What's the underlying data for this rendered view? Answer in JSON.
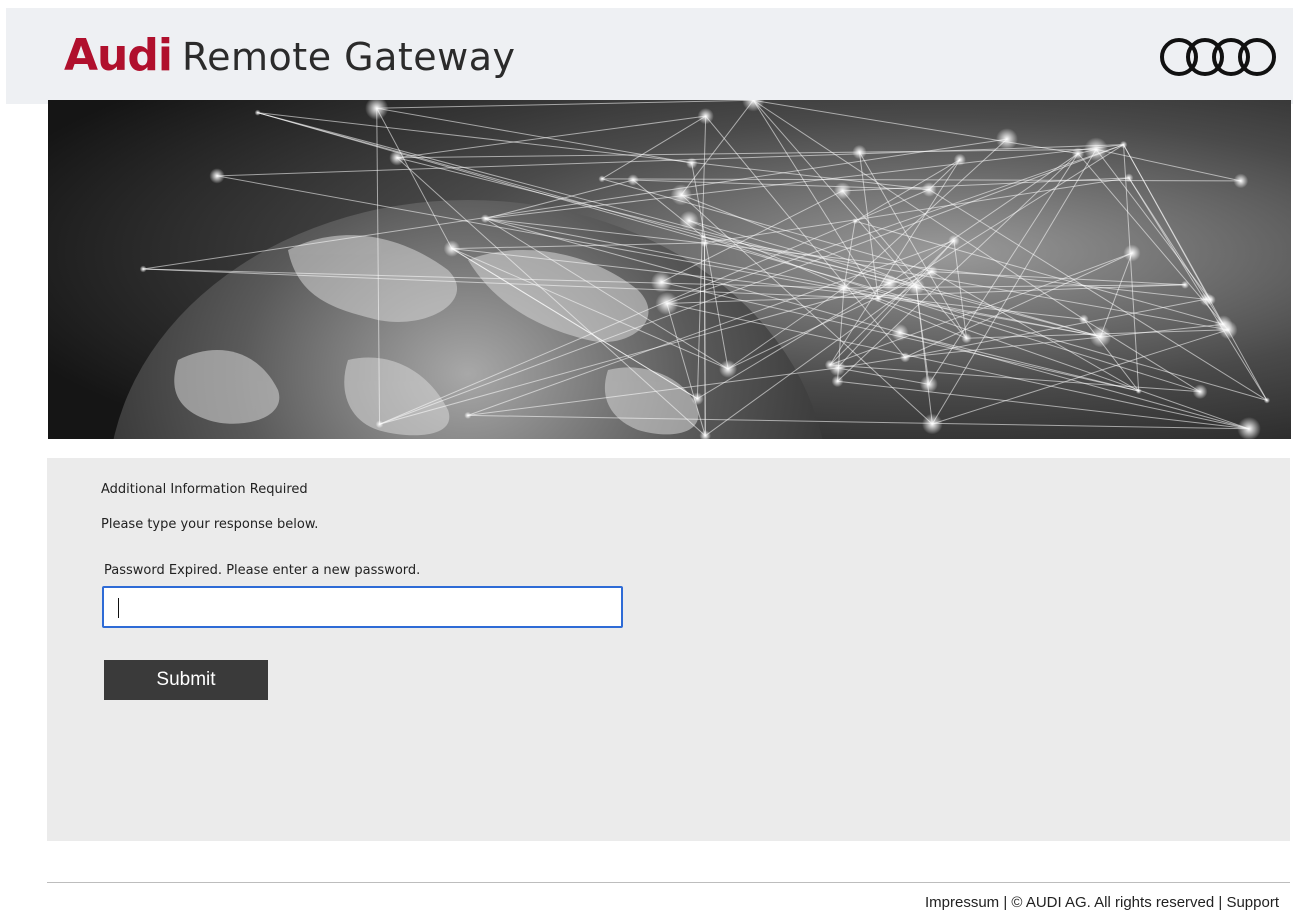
{
  "header": {
    "brand_primary": "Audi",
    "brand_secondary": "Remote Gateway",
    "logo_icon": "audi-rings-logo",
    "brand_color": "#b0102d"
  },
  "hero": {
    "image": "globe-network-photo"
  },
  "form": {
    "heading": "Additional Information Required",
    "instruction": "Please type your response below.",
    "field_label": "Password Expired. Please enter a new password.",
    "password_value": "",
    "submit_label": "Submit",
    "input_focus_color": "#2e6bd6"
  },
  "footer": {
    "impressum": "Impressum",
    "sep1": " | ",
    "copyright": "© AUDI AG. All rights reserved",
    "sep2": " | ",
    "support": "Support"
  }
}
